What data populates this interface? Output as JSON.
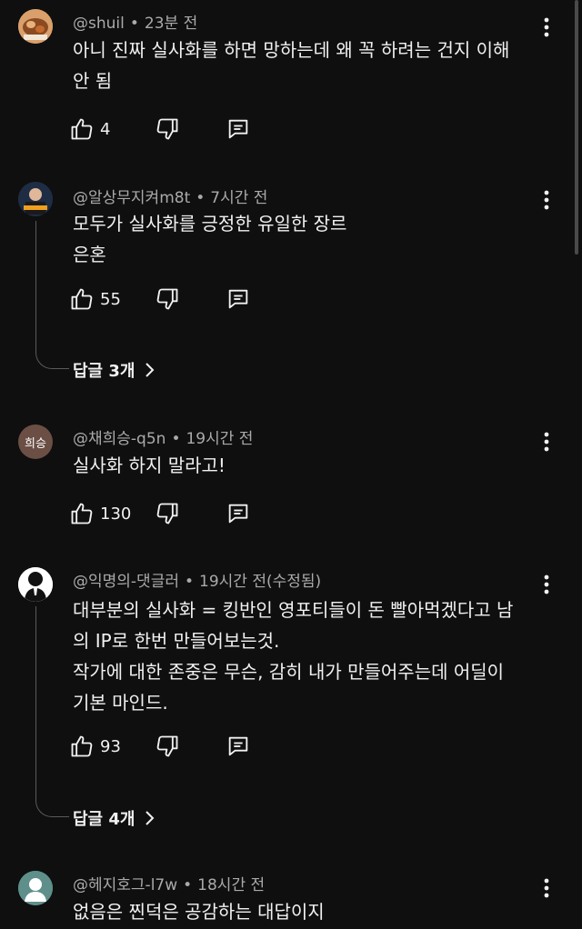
{
  "comments": [
    {
      "handle": "@shuil",
      "time": "23분 전",
      "lines": [
        "아니 진짜 실사화를 하면 망하는데 왜 꼭 하려는 건지 이해",
        "안 됨"
      ],
      "likes": "4"
    },
    {
      "handle": "@알상무지켜m8t",
      "time": "7시간 전",
      "lines": [
        "모두가 실사화를 긍정한 유일한 장르",
        "은혼"
      ],
      "likes": "55",
      "replies_label": "답글 3개"
    },
    {
      "handle": "@채희승-q5n",
      "time": "19시간 전",
      "avatar_text": "희승",
      "lines": [
        "실사화 하지 말라고!"
      ],
      "likes": "130"
    },
    {
      "handle": "@익명의-댓글러",
      "time": "19시간 전(수정됨)",
      "avatar_text": "?",
      "lines": [
        "대부분의 실사화 = 킹반인 영포티들이 돈 빨아먹겠다고 남",
        "의 IP로 한번 만들어보는것.",
        "작가에 대한 존중은 무슨, 감히 내가 만들어주는데 어딜이",
        "기본 마인드."
      ],
      "likes": "93",
      "replies_label": "답글 4개"
    },
    {
      "handle": "@헤지호그-l7w",
      "time": "18시간 전",
      "lines": [
        "없음은 찐덕은 공감하는 대답이지"
      ]
    }
  ],
  "separator": "•",
  "colors": {
    "background": "#0f0f0f",
    "text": "#f1f1f1",
    "meta": "#aaaaaa",
    "avatar_chaeheeseung": "#6b4f45",
    "avatar_hedgehog": "#5e8f8a"
  }
}
